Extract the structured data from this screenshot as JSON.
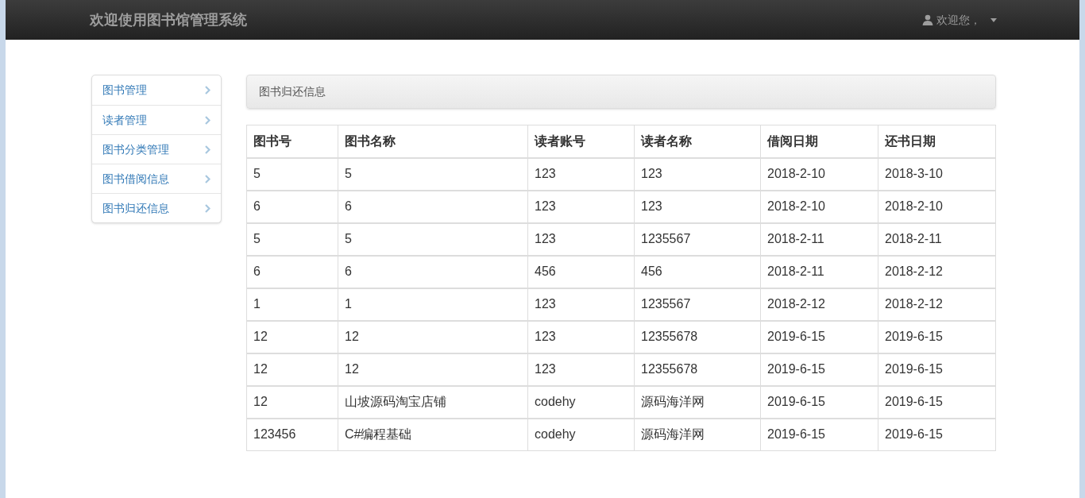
{
  "navbar": {
    "brand": "欢迎使用图书馆管理系统",
    "user_menu": "欢迎您，"
  },
  "sidebar": {
    "items": [
      {
        "label": "图书管理"
      },
      {
        "label": "读者管理"
      },
      {
        "label": "图书分类管理"
      },
      {
        "label": "图书借阅信息"
      },
      {
        "label": "图书归还信息"
      }
    ]
  },
  "panel": {
    "title": "图书归还信息"
  },
  "table": {
    "columns": [
      "图书号",
      "图书名称",
      "读者账号",
      "读者名称",
      "借阅日期",
      "还书日期"
    ],
    "rows": [
      [
        "5",
        "5",
        "123",
        "123",
        "2018-2-10",
        "2018-3-10"
      ],
      [
        "6",
        "6",
        "123",
        "123",
        "2018-2-10",
        "2018-2-10"
      ],
      [
        "5",
        "5",
        "123",
        "1235567",
        "2018-2-11",
        "2018-2-11"
      ],
      [
        "6",
        "6",
        "456",
        "456",
        "2018-2-11",
        "2018-2-12"
      ],
      [
        "1",
        "1",
        "123",
        "1235567",
        "2018-2-12",
        "2018-2-12"
      ],
      [
        "12",
        "12",
        "123",
        "12355678",
        "2019-6-15",
        "2019-6-15"
      ],
      [
        "12",
        "12",
        "123",
        "12355678",
        "2019-6-15",
        "2019-6-15"
      ],
      [
        "12",
        "山坡源码淘宝店铺",
        "codehy",
        "源码海洋网",
        "2019-6-15",
        "2019-6-15"
      ],
      [
        "123456",
        "C#编程基础",
        "codehy",
        "源码海洋网",
        "2019-6-15",
        "2019-6-15"
      ]
    ]
  }
}
